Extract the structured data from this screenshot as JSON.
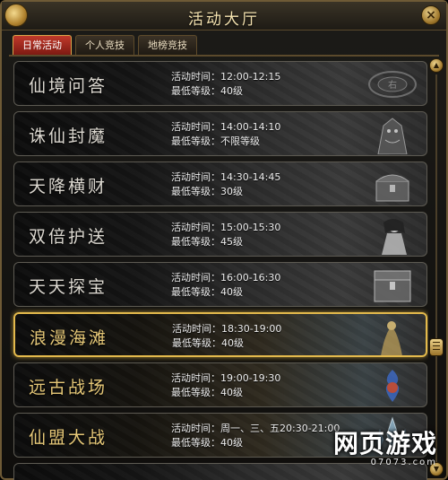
{
  "window": {
    "title": "活动大厅",
    "close_label": "×"
  },
  "tabs": [
    {
      "label": "日常活动",
      "active": true
    },
    {
      "label": "个人竞技",
      "active": false
    },
    {
      "label": "地榜竞技",
      "active": false
    }
  ],
  "activities": [
    {
      "name": "仙境问答",
      "time_label": "活动时间：",
      "time": "12:00-12:15",
      "level_label": "最低等级：",
      "level": "40级",
      "icon": "stone-seal-icon"
    },
    {
      "name": "诛仙封魔",
      "time_label": "活动时间：",
      "time": "14:00-14:10",
      "level_label": "最低等级：",
      "level": "不限等级",
      "icon": "demon-statue-icon"
    },
    {
      "name": "天降横财",
      "time_label": "活动时间：",
      "time": "14:30-14:45",
      "level_label": "最低等级：",
      "level": "30级",
      "icon": "treasure-chest-icon"
    },
    {
      "name": "双倍护送",
      "time_label": "活动时间：",
      "time": "15:00-15:30",
      "level_label": "最低等级：",
      "level": "45级",
      "icon": "fairy-girl-icon"
    },
    {
      "name": "天天探宝",
      "time_label": "活动时间：",
      "time": "16:00-16:30",
      "level_label": "最低等级：",
      "level": "40级",
      "icon": "treasure-chest-icon"
    },
    {
      "name": "浪漫海滩",
      "time_label": "活动时间：",
      "time": "18:30-19:00",
      "level_label": "最低等级：",
      "level": "40级",
      "icon": "beach-statue-icon",
      "highlighted": true
    },
    {
      "name": "远古战场",
      "time_label": "活动时间：",
      "time": "19:00-19:30",
      "level_label": "最低等级：",
      "level": "40级",
      "icon": "flame-lantern-icon"
    },
    {
      "name": "仙盟大战",
      "time_label": "活动时间：",
      "time": "周一、三、五20:30-21:00",
      "level_label": "最低等级：",
      "level": "40级",
      "icon": "crystal-spire-icon"
    }
  ],
  "scrollbar": {
    "up": "▲",
    "down": "▼"
  },
  "watermark": {
    "main": "网页游戏",
    "sub": "07073.com"
  },
  "colors": {
    "accent_gold": "#e3b94c",
    "tab_active": "#c0392b",
    "gold_name": "#e5c777"
  }
}
